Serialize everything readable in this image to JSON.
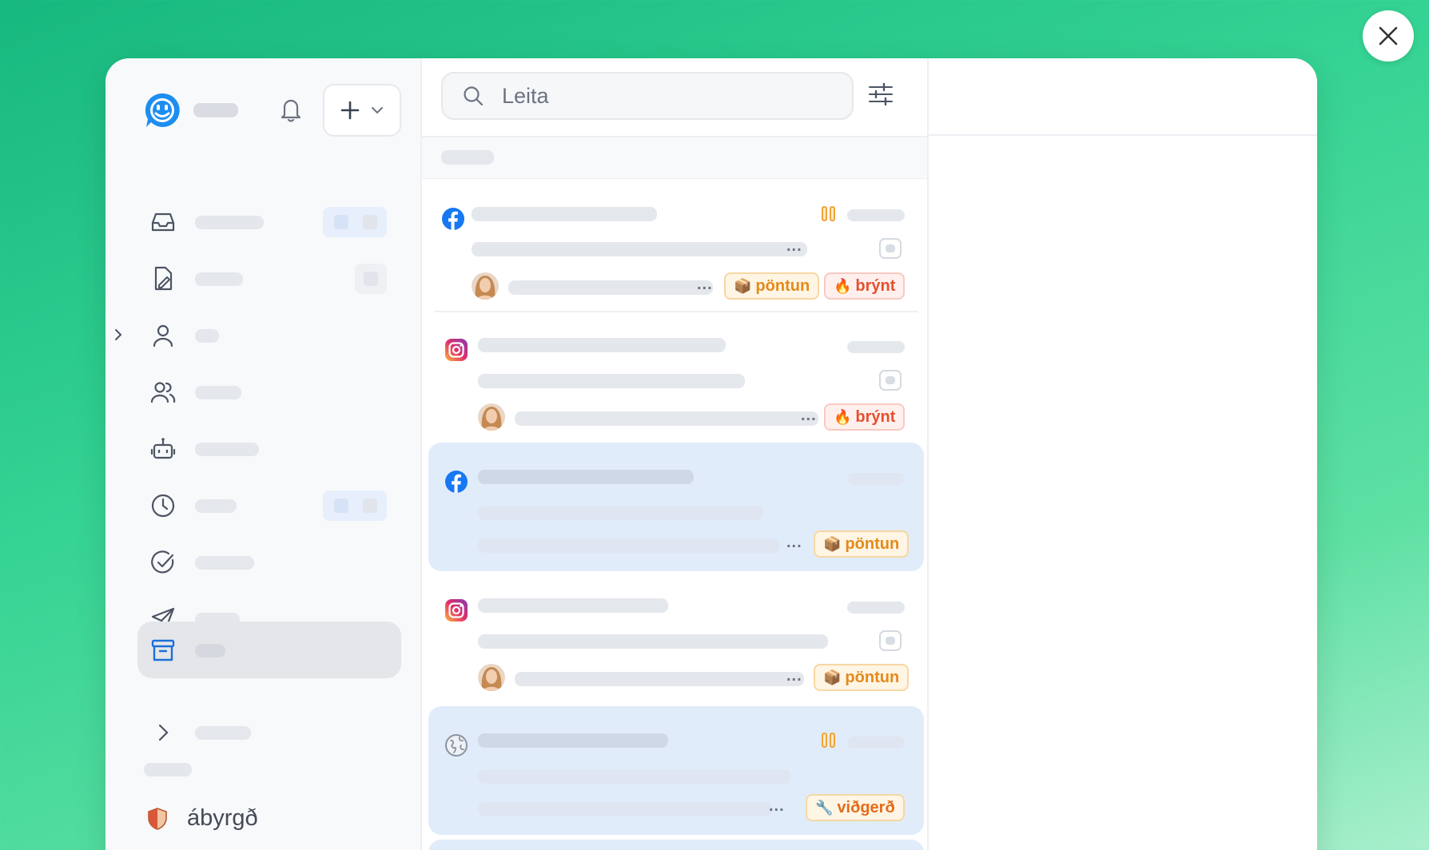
{
  "search": {
    "placeholder": "Leita"
  },
  "team": {
    "label": "ábyrgð"
  },
  "tags": {
    "order": "pöntun",
    "urgent": "brýnt",
    "repair": "viðgerð"
  },
  "icons": {
    "close": "close-icon",
    "logo": "smiley-logo-icon",
    "bell": "bell-icon",
    "plus": "plus-icon",
    "inbox": "inbox-icon",
    "draft": "draft-icon",
    "contact": "person-icon",
    "team": "people-icon",
    "bot": "bot-icon",
    "snoozed": "clock-icon",
    "done": "check-circle-icon",
    "sent": "send-icon",
    "archive": "archive-icon",
    "filter": "sliders-icon",
    "facebook": "facebook-icon",
    "instagram": "instagram-icon",
    "web": "globe-icon",
    "team_badge": "shield-icon"
  },
  "colors": {
    "background_start": "#17b87f",
    "background_end": "#a9efcd",
    "brand_blue": "#1d8ef0",
    "selected_row": "#e1ecfb",
    "order_tag": "#e48a1b",
    "urgent_tag": "#e4502f"
  }
}
